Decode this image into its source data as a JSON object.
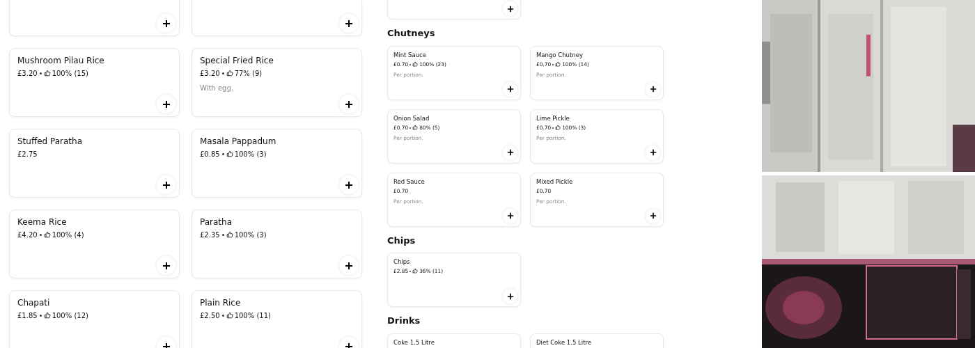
{
  "left_menu": {
    "items": [
      {
        "kind": "cut"
      },
      {
        "kind": "cut"
      },
      {
        "kind": "item",
        "name": "Mushroom Pilau Rice",
        "price": "£3.20",
        "rating": "100%",
        "reviews": "(15)"
      },
      {
        "kind": "item",
        "name": "Special Fried Rice",
        "price": "£3.20",
        "rating": "77%",
        "reviews": "(9)",
        "note": "With egg."
      },
      {
        "kind": "item",
        "name": "Stuffed Paratha",
        "price": "£2.75"
      },
      {
        "kind": "item",
        "name": "Masala Pappadum",
        "price": "£0.85",
        "rating": "100%",
        "reviews": "(3)"
      },
      {
        "kind": "item",
        "name": "Keema Rice",
        "price": "£4.20",
        "rating": "100%",
        "reviews": "(4)"
      },
      {
        "kind": "item",
        "name": "Paratha",
        "price": "£2.35",
        "rating": "100%",
        "reviews": "(3)"
      },
      {
        "kind": "item",
        "name": "Chapati",
        "price": "£1.85",
        "rating": "100%",
        "reviews": "(12)"
      },
      {
        "kind": "item",
        "name": "Plain Rice",
        "price": "£2.50",
        "rating": "100%",
        "reviews": "(11)"
      }
    ]
  },
  "right_menu": {
    "top_items": [
      {
        "kind": "cut"
      }
    ],
    "sections": [
      {
        "title": "Chutneys",
        "items": [
          {
            "kind": "item",
            "name": "Mint Sauce",
            "price": "£0.70",
            "rating": "100%",
            "reviews": "(23)",
            "note": "Per portion."
          },
          {
            "kind": "item",
            "name": "Mango Chutney",
            "price": "£0.70",
            "rating": "100%",
            "reviews": "(14)",
            "note": "Per portion."
          },
          {
            "kind": "item",
            "name": "Onion Salad",
            "price": "£0.70",
            "rating": "80%",
            "reviews": "(5)",
            "note": "Per portion."
          },
          {
            "kind": "item",
            "name": "Lime Pickle",
            "price": "£0.70",
            "rating": "100%",
            "reviews": "(3)",
            "note": "Per portion."
          },
          {
            "kind": "item",
            "name": "Red Sauce",
            "price": "£0.70",
            "note": "Per portion."
          },
          {
            "kind": "item",
            "name": "Mixed Pickle",
            "price": "£0.70",
            "note": "Per portion."
          }
        ]
      },
      {
        "title": "Chips",
        "items": [
          {
            "kind": "item",
            "name": "Chips",
            "price": "£2.85",
            "rating": "36%",
            "reviews": "(11)"
          }
        ]
      },
      {
        "title": "Drinks",
        "items": [
          {
            "kind": "item",
            "name": "Coke 1.5 Litre"
          },
          {
            "kind": "item",
            "name": "Diet Coke 1.5 Litre"
          }
        ]
      }
    ]
  }
}
